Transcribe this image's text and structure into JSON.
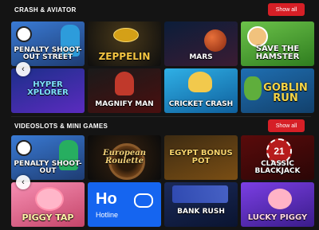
{
  "sections": [
    {
      "title": "CRASH & AVIATOR",
      "show_all_label": "Show all",
      "tiles": [
        {
          "name": "penalty-shoot-out-street",
          "label": "PENALTY SHOOT-OUT STREET"
        },
        {
          "name": "zeppelin",
          "label": "ZEPPELIN"
        },
        {
          "name": "mars",
          "label": "MARS"
        },
        {
          "name": "save-the-hamster",
          "label": "SAVE THE HAMSTER"
        },
        {
          "name": "hyper-xplorer",
          "label": "HYPER XPLORER"
        },
        {
          "name": "magnify-man",
          "label": "MAGNIFY MAN"
        },
        {
          "name": "cricket-crash",
          "label": "CRICKET CRASH"
        },
        {
          "name": "goblin-run",
          "label": "GOBLIN RUN"
        }
      ]
    },
    {
      "title": "VIDEOSLOTS & MINI GAMES",
      "show_all_label": "Show all",
      "tiles": [
        {
          "name": "penalty-shoot-out",
          "label": "PENALTY SHOOT-OUT"
        },
        {
          "name": "european-roulette",
          "label": "European Roulette"
        },
        {
          "name": "egypt-bonus-pot",
          "label": "EGYPT BONUS POT"
        },
        {
          "name": "classic-blackjack",
          "label": "CLASSIC BLACKJACK"
        },
        {
          "name": "piggy-tap",
          "label": "PIGGY TAP"
        },
        {
          "name": "hotline",
          "label": "Hotline",
          "logo": "Ho"
        },
        {
          "name": "heist-bank-rush",
          "label": "BANK RUSH"
        },
        {
          "name": "lucky-piggy",
          "label": "LUCKY PIGGY"
        }
      ]
    }
  ],
  "arrows": {
    "left": "‹"
  },
  "blackjack_number": "21",
  "colors": {
    "background": "#141414",
    "accent": "#d61f26"
  }
}
